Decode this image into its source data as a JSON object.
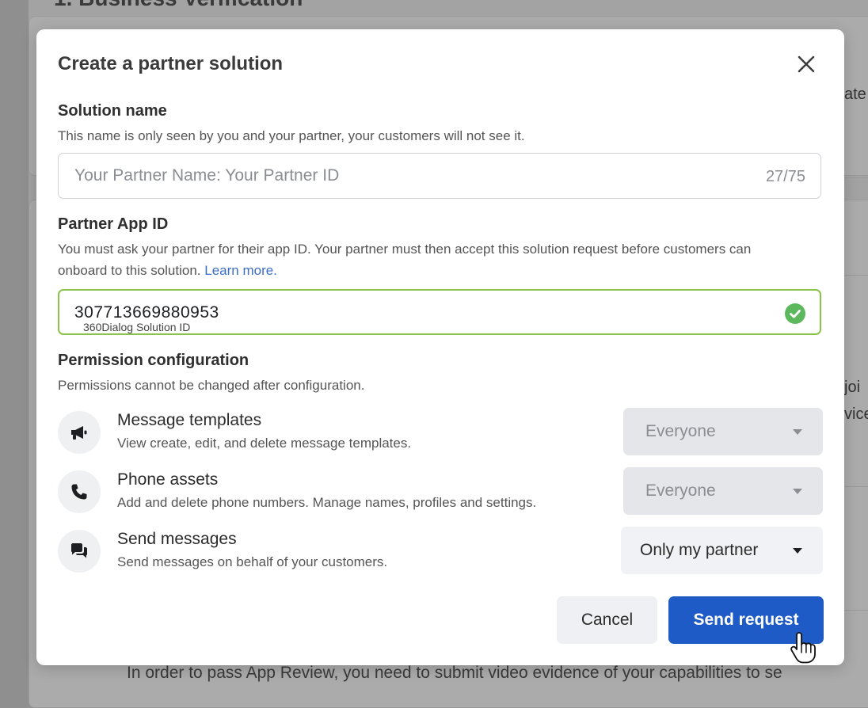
{
  "background": {
    "heading": "1. Business Verification",
    "fragments": [
      "ate",
      "joi",
      "vice"
    ],
    "bottom_text": "In order to pass App Review, you need to submit video evidence of your capabilities to se"
  },
  "modal": {
    "title": "Create a partner solution",
    "close_icon": "close-icon",
    "solution_name": {
      "label": "Solution name",
      "description": "This name is only seen by you and your partner, your customers will not see it.",
      "placeholder": "Your Partner Name: Your Partner ID",
      "counter": "27/75"
    },
    "partner_app_id": {
      "label": "Partner App ID",
      "description": "You must ask your partner for their app ID. Your partner must then accept this solution request before customers can onboard to this solution.",
      "learn_more": "Learn more.",
      "value": "307713669880953",
      "annotation": "360Dialog Solution ID",
      "valid_icon": "check-circle-icon",
      "valid_color": "#5cb85c"
    },
    "permissions": {
      "label": "Permission configuration",
      "description": "Permissions cannot be changed after configuration.",
      "items": [
        {
          "icon": "megaphone-icon",
          "title": "Message templates",
          "description": "View create, edit, and delete message templates.",
          "selected": "Everyone",
          "enabled": false
        },
        {
          "icon": "phone-icon",
          "title": "Phone assets",
          "description": "Add and delete phone numbers. Manage names, profiles and settings.",
          "selected": "Everyone",
          "enabled": false
        },
        {
          "icon": "chat-bubbles-icon",
          "title": "Send messages",
          "description": "Send messages on behalf of your customers.",
          "selected": "Only my partner",
          "enabled": true
        }
      ]
    },
    "actions": {
      "cancel_label": "Cancel",
      "send_label": "Send request",
      "send_color": "#1e5bc6"
    }
  }
}
